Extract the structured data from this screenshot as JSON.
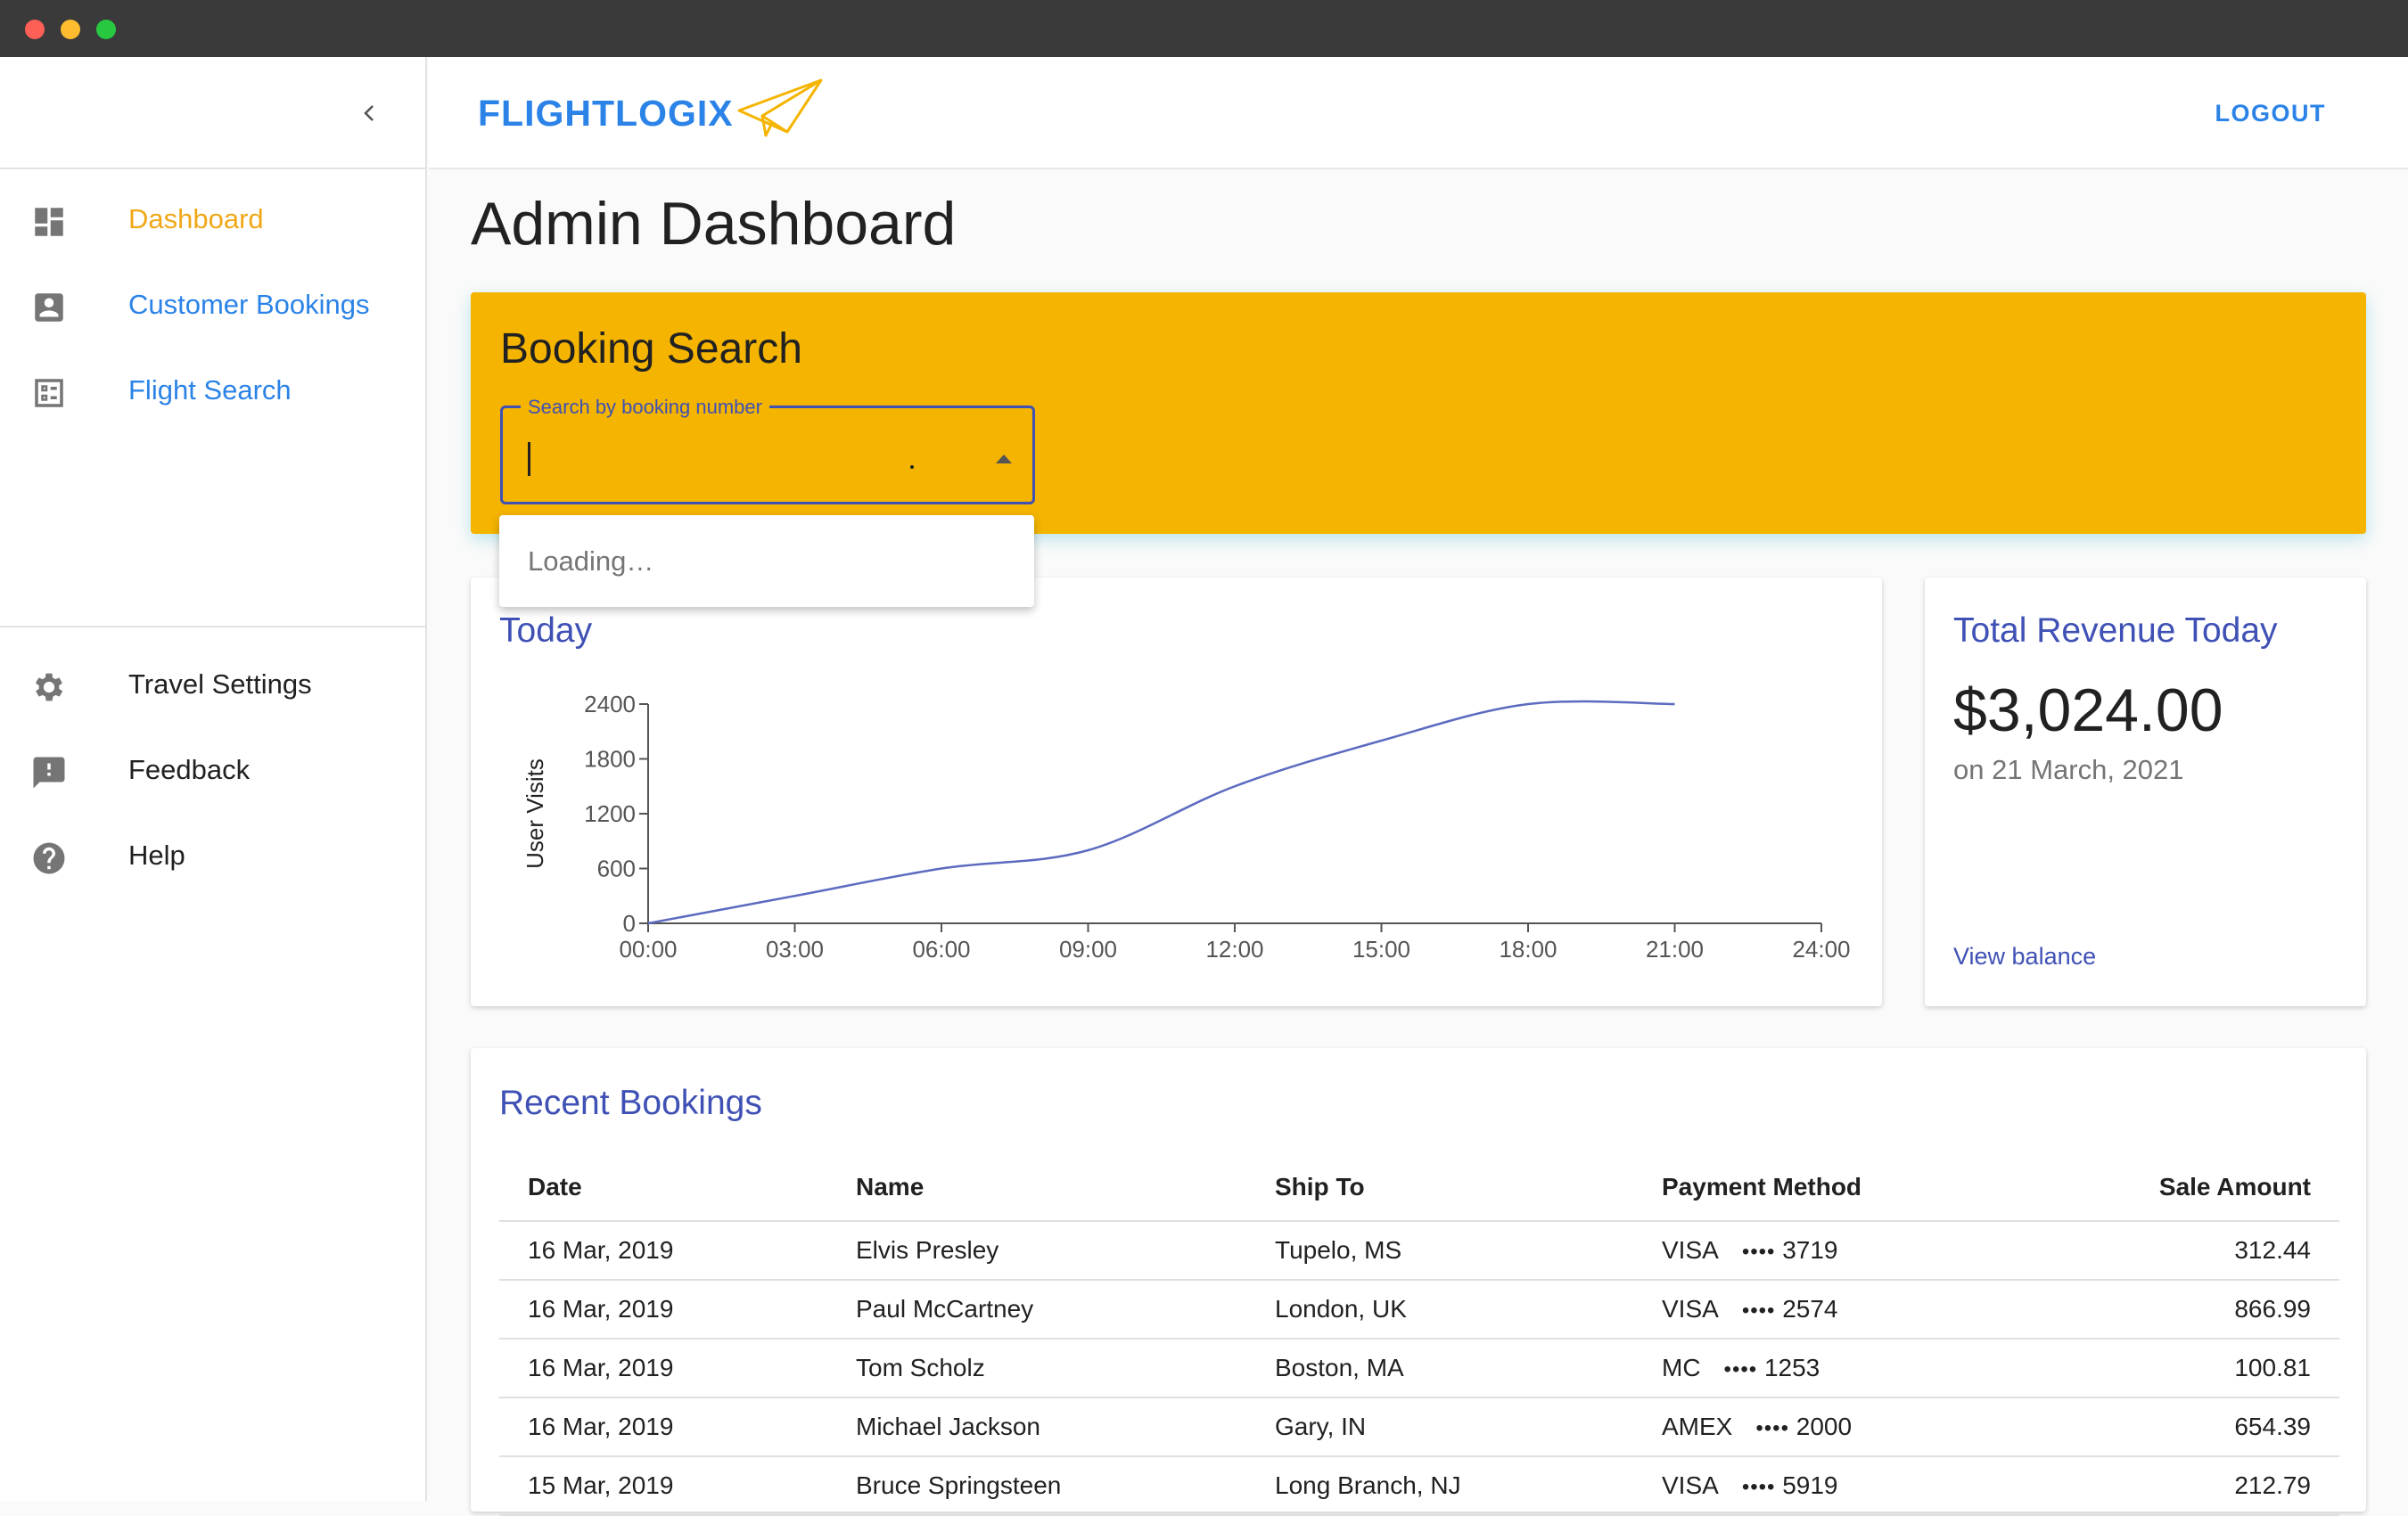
{
  "sidebar": {
    "nav_primary": [
      {
        "label": "Dashboard",
        "icon": "dashboard-icon"
      },
      {
        "label": "Customer Bookings",
        "icon": "account-box-icon"
      },
      {
        "label": "Flight Search",
        "icon": "list-alt-icon"
      }
    ],
    "nav_secondary": [
      {
        "label": "Travel Settings",
        "icon": "gear-icon"
      },
      {
        "label": "Feedback",
        "icon": "feedback-icon"
      },
      {
        "label": "Help",
        "icon": "help-icon"
      }
    ]
  },
  "header": {
    "logo_text": "FLIGHTLOGIX",
    "logout_label": "LOGOUT"
  },
  "page": {
    "title": "Admin Dashboard"
  },
  "booking_search": {
    "heading": "Booking Search",
    "field_label": "Search by booking number",
    "dropdown_text": "Loading…"
  },
  "chart_card": {
    "title": "Today"
  },
  "chart_data": {
    "type": "line",
    "title": "",
    "xlabel": "",
    "ylabel": "User Visits",
    "x": [
      "00:00",
      "03:00",
      "06:00",
      "09:00",
      "12:00",
      "15:00",
      "18:00",
      "21:00"
    ],
    "values": [
      0,
      300,
      600,
      800,
      1500,
      2000,
      2400,
      2400
    ],
    "x_ticks": [
      "00:00",
      "03:00",
      "06:00",
      "09:00",
      "12:00",
      "15:00",
      "18:00",
      "21:00",
      "24:00"
    ],
    "y_ticks": [
      "0",
      "600",
      "1200",
      "1800",
      "2400"
    ],
    "ylim": [
      0,
      2400
    ],
    "grid": false,
    "line_color": "#5c6bc0"
  },
  "revenue": {
    "title": "Total Revenue Today",
    "amount": "$3,024.00",
    "date": "on 21 March, 2021",
    "link_label": "View balance"
  },
  "bookings": {
    "title": "Recent Bookings",
    "columns": [
      "Date",
      "Name",
      "Ship To",
      "Payment Method",
      "Sale Amount"
    ],
    "rows": [
      {
        "date": "16 Mar, 2019",
        "name": "Elvis Presley",
        "ship_to": "Tupelo, MS",
        "card": "VISA",
        "last4": "3719",
        "amount": "312.44"
      },
      {
        "date": "16 Mar, 2019",
        "name": "Paul McCartney",
        "ship_to": "London, UK",
        "card": "VISA",
        "last4": "2574",
        "amount": "866.99"
      },
      {
        "date": "16 Mar, 2019",
        "name": "Tom Scholz",
        "ship_to": "Boston, MA",
        "card": "MC",
        "last4": "1253",
        "amount": "100.81"
      },
      {
        "date": "16 Mar, 2019",
        "name": "Michael Jackson",
        "ship_to": "Gary, IN",
        "card": "AMEX",
        "last4": "2000",
        "amount": "654.39"
      },
      {
        "date": "15 Mar, 2019",
        "name": "Bruce Springsteen",
        "ship_to": "Long Branch, NJ",
        "card": "VISA",
        "last4": "5919",
        "amount": "212.79"
      }
    ],
    "masked_dots": "••••"
  },
  "colors": {
    "accent_orange": "#f4b400",
    "primary_blue": "#2b83e8",
    "indigo": "#3f51b5"
  }
}
